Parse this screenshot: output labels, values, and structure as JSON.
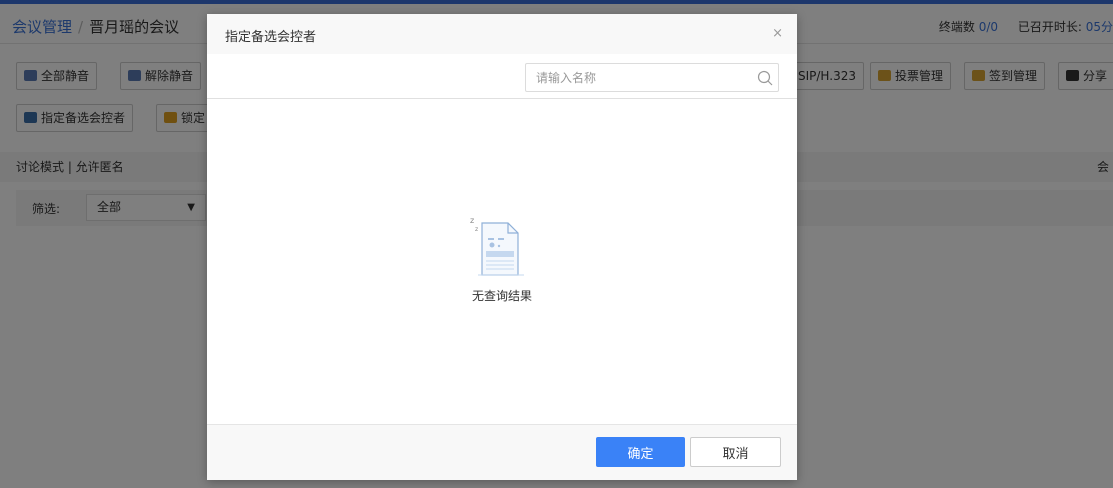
{
  "breadcrumb": {
    "root": "会议管理",
    "separator": "/",
    "current": "晋月瑶的会议"
  },
  "header_stats": {
    "terminals_label": "终端数",
    "terminals_value": "0/0",
    "duration_label": "已召开时长:",
    "duration_value": "05分"
  },
  "toolbar": {
    "row1": [
      {
        "label": "全部静音",
        "icon": "mute-all-icon",
        "color": "#5b7bb5"
      },
      {
        "label": "解除静音",
        "icon": "unmute-icon",
        "color": "#5b7bb5"
      },
      {
        "label": "SIP/H.323",
        "icon": "",
        "color": ""
      },
      {
        "label": "投票管理",
        "icon": "vote-icon",
        "color": "#d9a432"
      },
      {
        "label": "签到管理",
        "icon": "checkin-icon",
        "color": "#d9a432"
      },
      {
        "label": "分享",
        "icon": "share-icon",
        "color": "#333333"
      }
    ],
    "row2": [
      {
        "label": "指定备选会控者",
        "icon": "user-assign-icon",
        "color": "#3a6fa8"
      },
      {
        "label": "锁定",
        "icon": "lock-icon",
        "color": "#e0a020"
      }
    ]
  },
  "modebar": {
    "text": "讨论模式 | 允许匿名",
    "right": "会"
  },
  "filter": {
    "label": "筛选:",
    "value": "全部"
  },
  "modal": {
    "title": "指定备选会控者",
    "close": "×",
    "search_placeholder": "请输入名称",
    "empty_text": "无查询结果",
    "ok_label": "确定",
    "cancel_label": "取消",
    "accent": "#3a82f7"
  }
}
